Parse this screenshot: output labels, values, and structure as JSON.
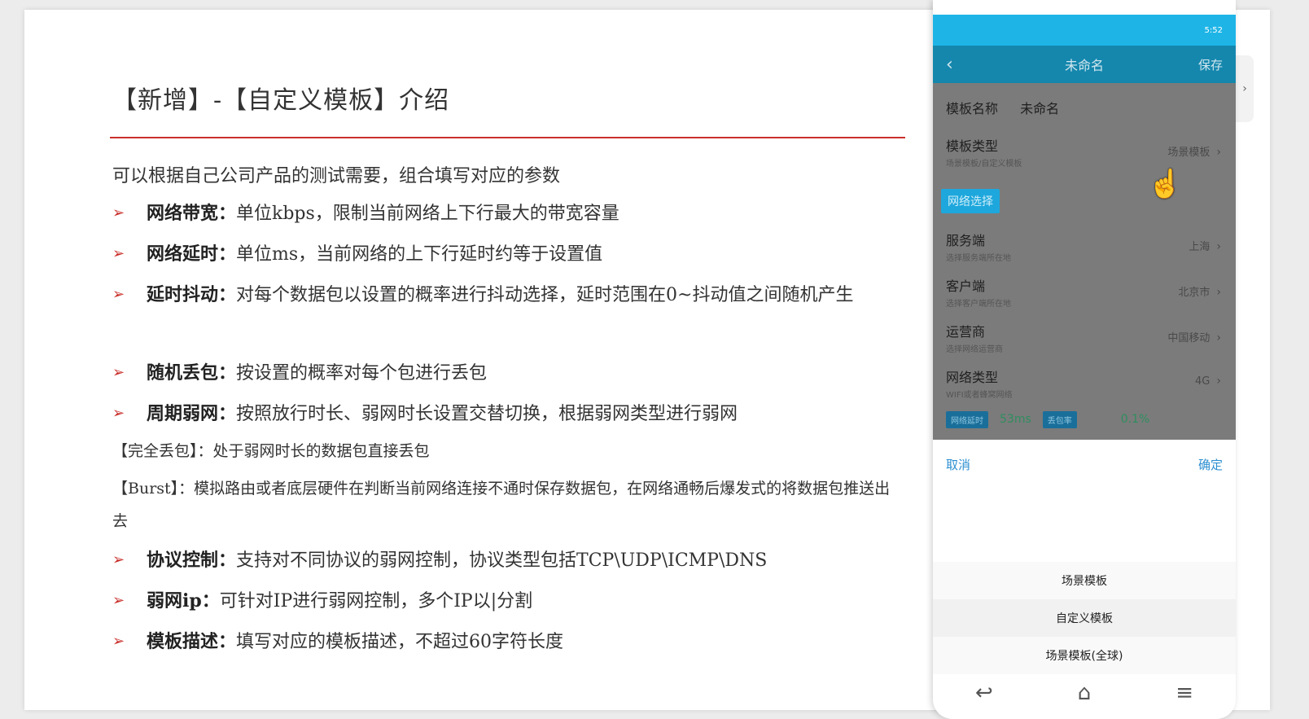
{
  "slide": {
    "title": "【新增】-【自定义模板】介绍",
    "intro": "可以根据自己公司产品的测试需要，组合填写对应的参数",
    "bullets": [
      {
        "label": "网络带宽：",
        "text": "单位kbps，限制当前网络上下行最大的带宽容量"
      },
      {
        "label": "网络延时：",
        "text": "单位ms，当前网络的上下行延时约等于设置值"
      },
      {
        "label": "延时抖动：",
        "text": "对每个数据包以设置的概率进行抖动选择，延时范围在0~抖动值之间随机产生"
      },
      {
        "label": "随机丢包：",
        "text": "按设置的概率对每个包进行丢包"
      },
      {
        "label": "周期弱网：",
        "text": "按照放行时长、弱网时长设置交替切换，根据弱网类型进行弱网"
      },
      {
        "label": "协议控制：",
        "text": "支持对不同协议的弱网控制，协议类型包括TCP\\UDP\\ICMP\\DNS"
      },
      {
        "label": "弱网ip：",
        "text": "可针对IP进行弱网控制，多个IP以|分割"
      },
      {
        "label": "模板描述：",
        "text": "填写对应的模板描述，不超过60字符长度"
      }
    ],
    "note_full_drop": "【完全丢包】：处于弱网时长的数据包直接丢包",
    "note_burst": "【Burst】：模拟路由或者底层硬件在判断当前网络连接不通时保存数据包，在网络通畅后爆发式的将数据包推送出去",
    "arrow_glyph": "➢"
  },
  "phone": {
    "status_time": "5:52",
    "appbar": {
      "back": "‹",
      "title": "未命名",
      "save": "保存"
    },
    "template_name": {
      "label": "模板名称",
      "value": "未命名"
    },
    "template_type": {
      "label": "模板类型",
      "sub": "场景模板/自定义模板",
      "value": "场景模板"
    },
    "net_chip": "网络选择",
    "server": {
      "label": "服务端",
      "sub": "选择服务端所在地",
      "value": "上海"
    },
    "client": {
      "label": "客户端",
      "sub": "选择客户端所在地",
      "value": "北京市"
    },
    "carrier": {
      "label": "运营商",
      "sub": "选择网络运营商",
      "value": "中国移动"
    },
    "net_type": {
      "label": "网络类型",
      "sub": "WIFI或者蜂窝网络",
      "value": "4G"
    },
    "stats": {
      "delay_label": "网络延时",
      "delay_value": "53ms",
      "loss_label": "丢包率",
      "loss_value": "0.1%"
    },
    "cancel": "取消",
    "confirm": "确定",
    "sheet_options": [
      "场景模板",
      "自定义模板",
      "场景模板(全球)"
    ],
    "chevron": "›",
    "nav": {
      "back": "↩",
      "home": "⌂",
      "menu": "≡"
    }
  },
  "colors": {
    "accent_red": "#c9302c",
    "phone_blue": "#1eb5e6",
    "link_blue": "#2d8fd1"
  }
}
